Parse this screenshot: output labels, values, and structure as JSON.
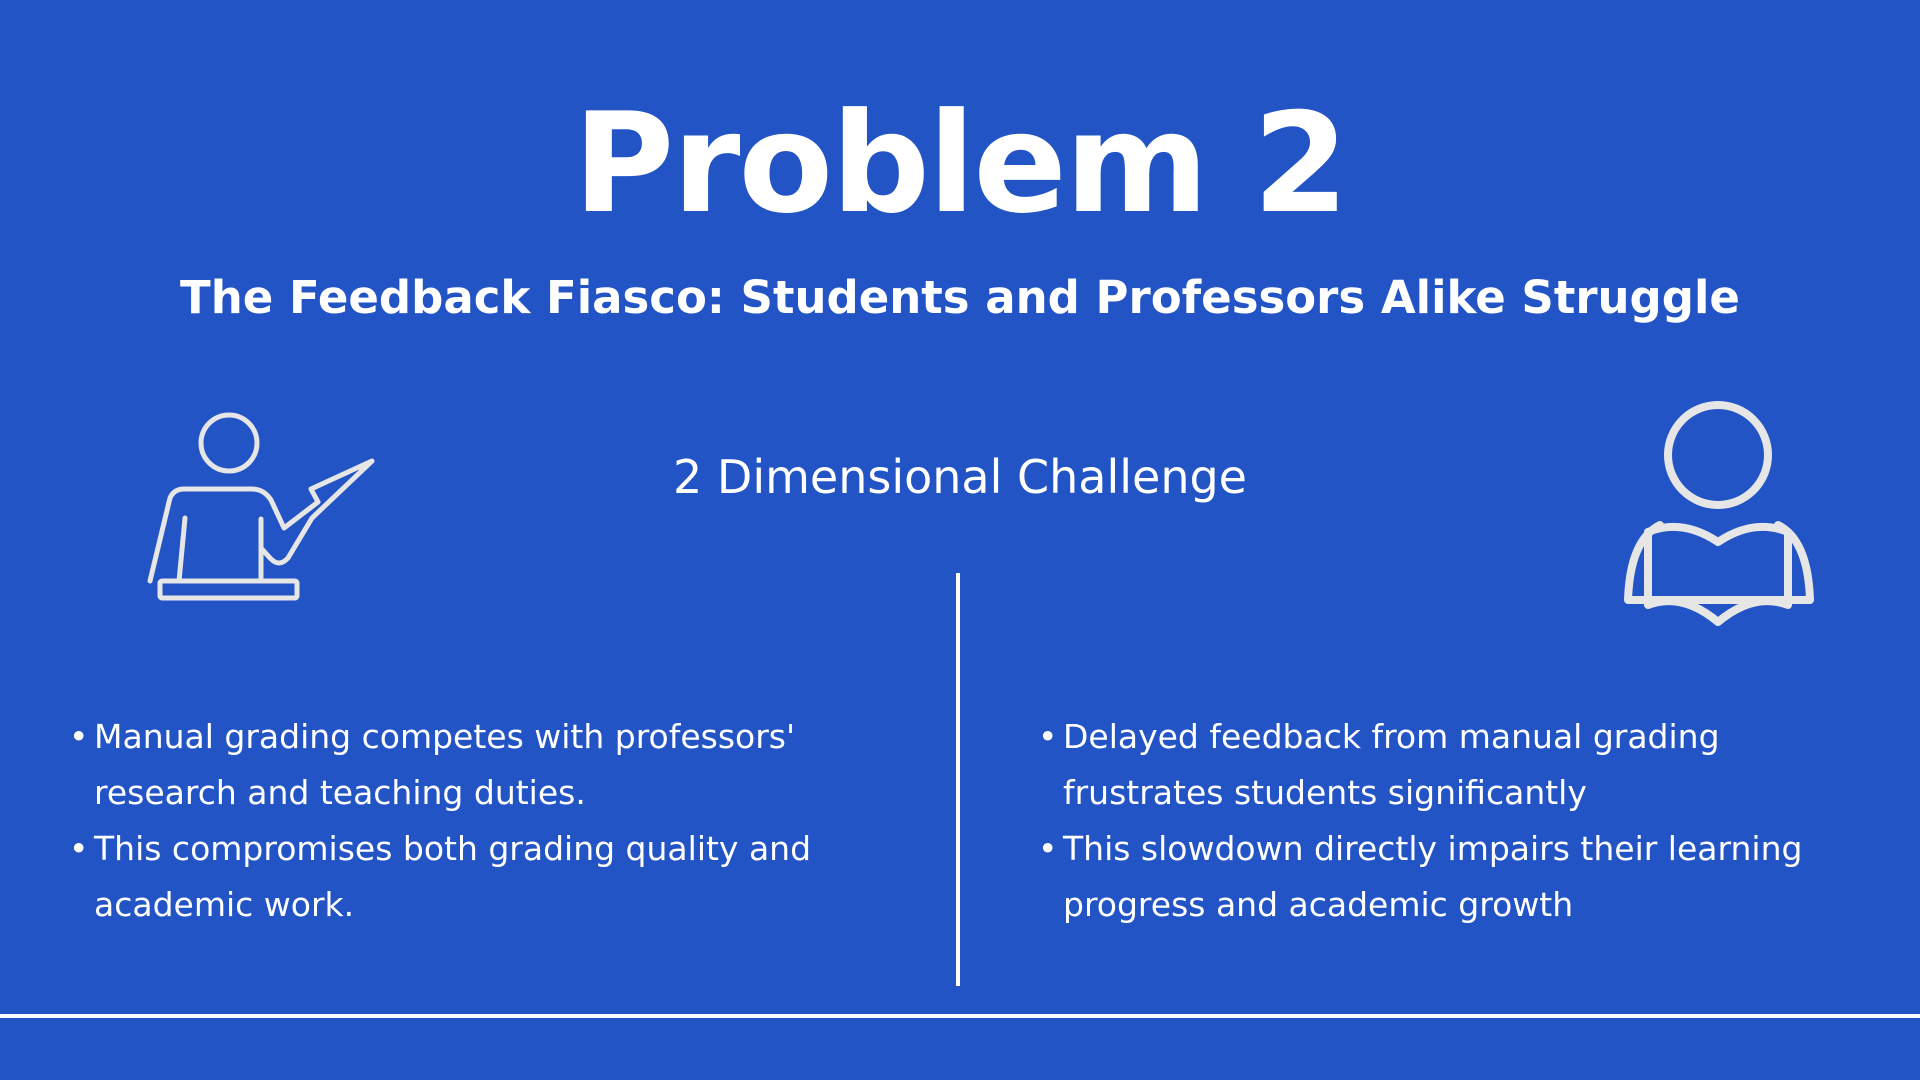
{
  "slide": {
    "title": "Problem 2",
    "subtitle": "The Feedback Fiasco: Students and Professors Alike Struggle",
    "challenge_label": "2 Dimensional Challenge",
    "colors": {
      "background": "#2254c5",
      "text": "#ffffff",
      "icon_stroke": "#e6e6e6"
    }
  },
  "left_column": {
    "icon": "teacher-with-pointer-icon",
    "bullets": [
      "Manual grading competes with professors' research and teaching duties.",
      "This compromises both grading quality and academic work."
    ]
  },
  "right_column": {
    "icon": "student-reading-book-icon",
    "bullets": [
      "Delayed feedback from manual grading frustrates students significantly",
      "This slowdown directly impairs their learning progress and academic growth"
    ]
  }
}
